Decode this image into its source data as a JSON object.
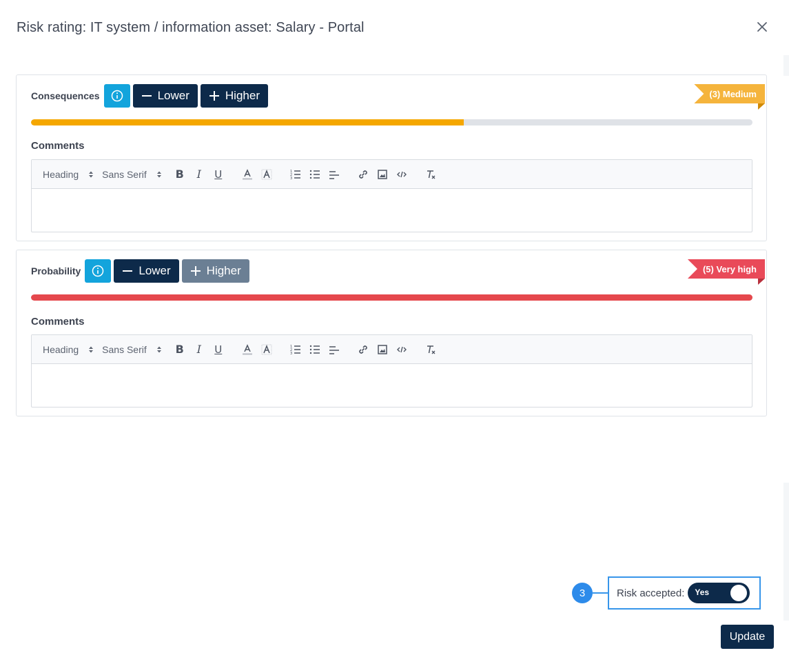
{
  "modal": {
    "title": "Risk rating: IT system / information asset: Salary - Portal"
  },
  "colors": {
    "dark_button": "#0d2a4a",
    "info_button": "#13a4dc",
    "medium": "#f5a700",
    "very_high": "#e5484d",
    "highlight": "#3795ea"
  },
  "consequences": {
    "label": "Consequences",
    "lower_label": "Lower",
    "higher_label": "Higher",
    "badge": "(3) Medium",
    "level_fraction": 0.6,
    "comments_label": "Comments"
  },
  "probability": {
    "label": "Probability",
    "lower_label": "Lower",
    "higher_label": "Higher",
    "badge": "(5) Very high",
    "level_fraction": 1.0,
    "comments_label": "Comments"
  },
  "editor_toolbar": {
    "heading_picker": "Heading",
    "font_picker": "Sans Serif",
    "bold": "B",
    "italic": "I",
    "underline": "U",
    "icons": [
      "text-color-icon",
      "background-color-icon",
      "ordered-list-icon",
      "bullet-list-icon",
      "align-icon",
      "link-icon",
      "image-icon",
      "code-icon",
      "clear-format-icon"
    ]
  },
  "risk_accepted": {
    "label": "Risk accepted:",
    "toggle_text": "Yes",
    "step_number": "3"
  },
  "footer": {
    "update_label": "Update"
  }
}
